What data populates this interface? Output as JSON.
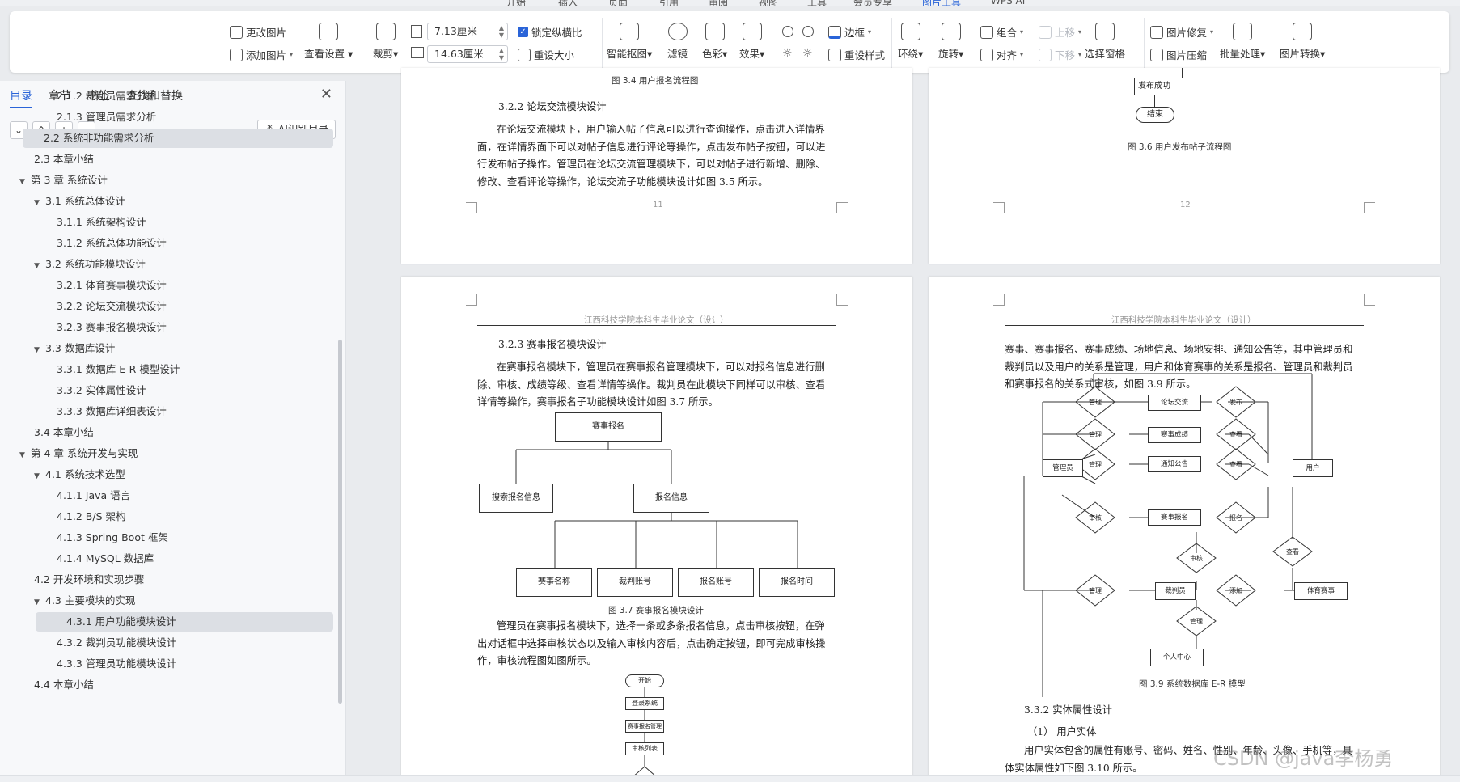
{
  "tabs": [
    "开始",
    "插入",
    "页面",
    "引用",
    "审阅",
    "视图",
    "工具",
    "会员专享",
    "图片工具",
    "WPS AI"
  ],
  "ribbon": {
    "change_pic": "更改图片",
    "add_pic": "添加图片",
    "view_settings": "查看设置",
    "crop": "裁剪",
    "width": "7.13厘米",
    "height": "14.63厘米",
    "lock_ratio": "锁定纵横比",
    "reset_size": "重设大小",
    "smart_cutout": "智能抠图",
    "filter": "滤镜",
    "color": "色彩",
    "effects": "效果",
    "border": "边框",
    "reset_style": "重设样式",
    "wrap": "环绕",
    "rotate": "旋转",
    "group": "组合",
    "align": "对齐",
    "move_up": "上移",
    "move_down": "下移",
    "selection_pane": "选择窗格",
    "pic_repair": "图片修复",
    "pic_compress": "图片压缩",
    "batch": "批量处理",
    "pic_convert": "图片转换"
  },
  "sidebar": {
    "tabs": [
      "目录",
      "章节",
      "书签",
      "查找和替换"
    ],
    "ai_toc": "AI识别目录",
    "toc": [
      {
        "label": "2.1.2  裁判员需求分析",
        "level": 3
      },
      {
        "label": "2.1.3  管理员需求分析",
        "level": 3
      },
      {
        "label": "2.2   系统非功能需求分析",
        "level": 2,
        "selected": true
      },
      {
        "label": "2.3   本章小结",
        "level": 2
      },
      {
        "label": "第 3 章  系统设计",
        "level": 1,
        "expand": true
      },
      {
        "label": "3.1  系统总体设计",
        "level": 2,
        "expand": true
      },
      {
        "label": "3.1.1  系统架构设计",
        "level": 3
      },
      {
        "label": "3.1.2  系统总体功能设计",
        "level": 3
      },
      {
        "label": "3.2  系统功能模块设计",
        "level": 2,
        "expand": true
      },
      {
        "label": "3.2.1  体育赛事模块设计",
        "level": 3
      },
      {
        "label": "3.2.2  论坛交流模块设计",
        "level": 3
      },
      {
        "label": "3.2.3  赛事报名模块设计",
        "level": 3
      },
      {
        "label": "3.3  数据库设计",
        "level": 2,
        "expand": true
      },
      {
        "label": "3.3.1  数据库 E-R 模型设计",
        "level": 3
      },
      {
        "label": "3.3.2  实体属性设计",
        "level": 3
      },
      {
        "label": "3.3.3  数据库详细表设计",
        "level": 3
      },
      {
        "label": "3.4   本章小结",
        "level": 2
      },
      {
        "label": "第 4 章  系统开发与实现",
        "level": 1,
        "expand": true
      },
      {
        "label": "4.1  系统技术选型",
        "level": 2,
        "expand": true
      },
      {
        "label": "4.1.1 Java 语言",
        "level": 3
      },
      {
        "label": "4.1.2 B/S 架构",
        "level": 3
      },
      {
        "label": "4.1.3 Spring Boot 框架",
        "level": 3
      },
      {
        "label": "4.1.4 MySQL 数据库",
        "level": 3
      },
      {
        "label": "4.2  开发环境和实现步骤",
        "level": 2
      },
      {
        "label": "4.3  主要模块的实现",
        "level": 2,
        "expand": true
      },
      {
        "label": "4.3.1  用户功能模块设计",
        "level": 3,
        "selected": true
      },
      {
        "label": "4.3.2  裁判员功能模块设计",
        "level": 3
      },
      {
        "label": "4.3.3  管理员功能模块设计",
        "level": 3
      },
      {
        "label": "4.4   本章小结",
        "level": 2
      }
    ]
  },
  "doc": {
    "p11": {
      "caption_top": "图 3.4  用户报名流程图",
      "heading": "3.2.2  论坛交流模块设计",
      "para": [
        "在论坛交流模块下，用户输入帖子信息可以进行查询操作，点击进入详情界",
        "面，在详情界面下可以对帖子信息进行评论等操作，点击发布帖子按钮，可以进",
        "行发布帖子操作。管理员在论坛交流管理模块下，可以对帖子进行新增、删除、",
        "修改、查看评论等操作，论坛交流子功能模块设计如图 3.5 所示。"
      ],
      "page_no": "11"
    },
    "p12": {
      "box_publish": "发布成功",
      "box_end": "结束",
      "caption": "图 3.6  用户发布帖子流程图",
      "page_no": "12"
    },
    "p13": {
      "header": "江西科技学院本科生毕业论文（设计）",
      "heading": "3.2.3  赛事报名模块设计",
      "para1": [
        "在赛事报名模块下，管理员在赛事报名管理模块下，可以对报名信息进行删",
        "除、审核、成绩等级、查看详情等操作。裁判员在此模块下同样可以审核、查看",
        "详情等操作，赛事报名子功能模块设计如图 3.7 所示。"
      ],
      "tree_root": "赛事报名",
      "tree_l2": [
        "搜索报名信息",
        "报名信息"
      ],
      "tree_l3": [
        "赛事名称",
        "裁判账号",
        "报名账号",
        "报名时间"
      ],
      "caption": "图 3.7  赛事报名模块设计",
      "para2": [
        "管理员在赛事报名模块下，选择一条或多条报名信息，点击审核按钮，在弹",
        "出对话框中选择审核状态以及输入审核内容后，点击确定按钮，即可完成审核操",
        "作，审核流程图如图所示。"
      ],
      "flow": [
        "开始",
        "登录系统",
        "赛事报名管理",
        "审核列表"
      ]
    },
    "p14": {
      "header": "江西科技学院本科生毕业论文（设计）",
      "para": [
        "赛事、赛事报名、赛事成绩、场地信息、场地安排、通知公告等，其中管理员和",
        "裁判员以及用户的关系是管理，用户和体育赛事的关系是报名、管理员和裁判员",
        "和赛事报名的关系式审核，如图 3.9 所示。"
      ],
      "er": {
        "entities": [
          "管理员",
          "论坛交流",
          "赛事成绩",
          "通知公告",
          "赛事报名",
          "用户",
          "裁判员",
          "体育赛事",
          "个人中心"
        ],
        "relations": [
          "管理",
          "发布",
          "管理",
          "查看",
          "管理",
          "查看",
          "审核",
          "报名",
          "审核",
          "管理",
          "添加",
          "查看",
          "管理"
        ]
      },
      "caption": "图 3.9  系统数据库 E-R 模型",
      "heading": "3.3.2  实体属性设计",
      "sub": "（1）  用户实体",
      "para2": [
        "用户实体包含的属性有账号、密码、姓名、性别、年龄、头像、手机等，具",
        "体实体属性如下图 3.10 所示。"
      ]
    }
  },
  "watermark": "CSDN @java李杨勇"
}
